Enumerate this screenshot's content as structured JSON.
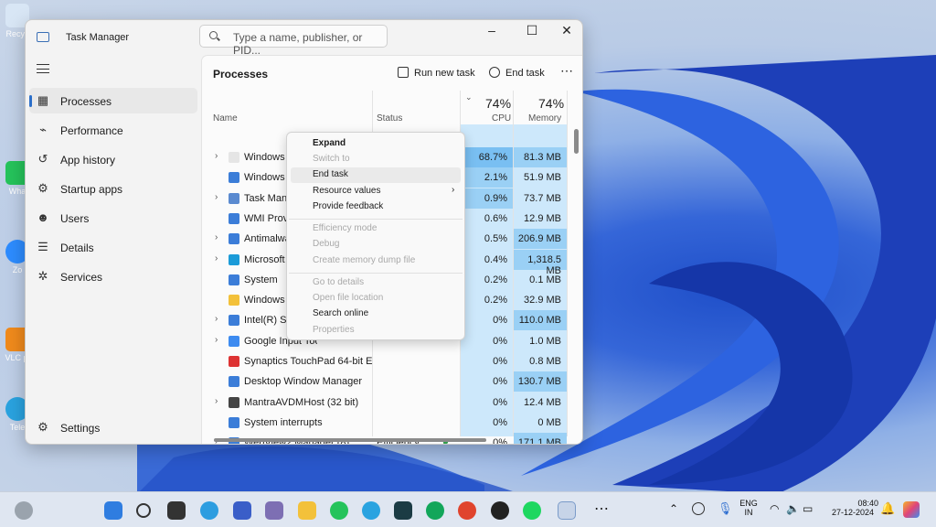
{
  "window": {
    "title": "Task Manager",
    "search_placeholder": "Type a name, publisher, or PID..."
  },
  "sidebar": {
    "items": [
      {
        "label": "Processes",
        "icon": "processes-icon"
      },
      {
        "label": "Performance",
        "icon": "performance-icon"
      },
      {
        "label": "App history",
        "icon": "history-icon"
      },
      {
        "label": "Startup apps",
        "icon": "startup-icon"
      },
      {
        "label": "Users",
        "icon": "users-icon"
      },
      {
        "label": "Details",
        "icon": "details-icon"
      },
      {
        "label": "Services",
        "icon": "services-icon"
      }
    ],
    "settings": "Settings"
  },
  "toolbar": {
    "title": "Processes",
    "run_new_task": "Run new task",
    "end_task": "End task",
    "more": "⋯"
  },
  "columns": {
    "name": "Name",
    "status": "Status",
    "cpu_pct": "74%",
    "cpu": "CPU",
    "mem_pct": "74%",
    "memory": "Memory"
  },
  "rows": [
    {
      "name": "Windows Input Experience",
      "status": "",
      "cpu": "68.7%",
      "mem": "81.3 MB"
    },
    {
      "name": "Windows Audio Device Graph Isolation",
      "status": "",
      "cpu": "2.1%",
      "mem": "51.9 MB"
    },
    {
      "name": "Task Manager",
      "status": "",
      "cpu": "0.9%",
      "mem": "73.7 MB"
    },
    {
      "name": "WMI Provider Host",
      "status": "",
      "cpu": "0.6%",
      "mem": "12.9 MB"
    },
    {
      "name": "Antimalware Service Executable",
      "status": "",
      "cpu": "0.5%",
      "mem": "206.9 MB"
    },
    {
      "name": "Microsoft Edge",
      "status": "",
      "cpu": "0.4%",
      "mem": "1,318.5 MB"
    },
    {
      "name": "System",
      "status": "",
      "cpu": "0.2%",
      "mem": "0.1 MB"
    },
    {
      "name": "Windows Explorer",
      "status": "",
      "cpu": "0.2%",
      "mem": "32.9 MB"
    },
    {
      "name": "Intel(R) System Usage Report",
      "status": "",
      "cpu": "0%",
      "mem": "110.0 MB"
    },
    {
      "name": "Google Input Tools",
      "status": "",
      "cpu": "0%",
      "mem": "1.0 MB"
    },
    {
      "name": "Synaptics TouchPad 64-bit Enh...",
      "status": "",
      "cpu": "0%",
      "mem": "0.8 MB"
    },
    {
      "name": "Desktop Window Manager",
      "status": "",
      "cpu": "0%",
      "mem": "130.7 MB"
    },
    {
      "name": "MantraAVDMHost (32 bit)",
      "status": "",
      "cpu": "0%",
      "mem": "12.4 MB"
    },
    {
      "name": "System interrupts",
      "status": "",
      "cpu": "0%",
      "mem": "0 MB"
    },
    {
      "name": "WebView2 Manager (8)",
      "status": "Efficiency ...",
      "cpu": "0%",
      "mem": "171.1 MB"
    }
  ],
  "context_menu": [
    {
      "label": "Expand",
      "enabled": true
    },
    {
      "label": "Switch to",
      "enabled": false
    },
    {
      "label": "End task",
      "enabled": true
    },
    {
      "label": "Resource values",
      "enabled": true
    },
    {
      "label": "Provide feedback",
      "enabled": true
    },
    {
      "label": "Efficiency mode",
      "enabled": false
    },
    {
      "label": "Debug",
      "enabled": false
    },
    {
      "label": "Create memory dump file",
      "enabled": false
    },
    {
      "label": "Go to details",
      "enabled": false
    },
    {
      "label": "Open file location",
      "enabled": false
    },
    {
      "label": "Search online",
      "enabled": true
    },
    {
      "label": "Properties",
      "enabled": false
    }
  ],
  "desktop_icons": [
    "Recyc",
    "Wha",
    "Zo",
    "VLC\npl",
    "Tele"
  ],
  "tray": {
    "lang1": "ENG",
    "lang2": "IN",
    "time": "08:40",
    "date": "27-12-2024"
  }
}
